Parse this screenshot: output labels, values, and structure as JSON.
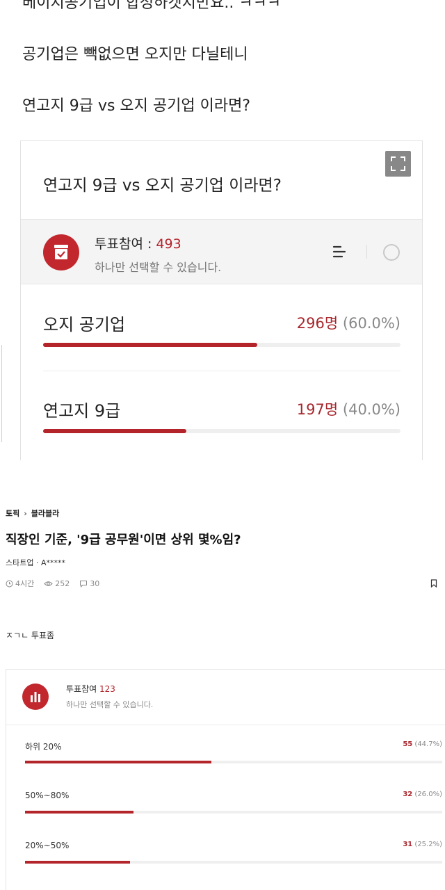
{
  "top": {
    "post_lines": [
      "베이지공기업이 합성하겟지만요.. ㅋㅋㅋ",
      "공기업은 빽없으면 오지만 다닐테니",
      "연고지 9급 vs 오지 공기업 이라면?"
    ],
    "poll": {
      "title": "연고지 9급 vs 오지 공기업 이라면?",
      "participation_label": "투표참여 : ",
      "participation_count": "493",
      "instruction": "하나만 선택할 수 있습니다.",
      "icons": {
        "expand": "expand-icon",
        "vote": "ballot-box-icon",
        "sort": "sort-icon",
        "radio": "radio-circle-icon"
      },
      "options": [
        {
          "label": "오지 공기업",
          "count": "296명",
          "percent_text": "(60.0%)",
          "fraction": 0.6
        },
        {
          "label": "연고지 9급",
          "count": "197명",
          "percent_text": "(40.0%)",
          "fraction": 0.4
        }
      ]
    }
  },
  "bottom": {
    "breadcrumb": {
      "topic": "토픽",
      "arrow": "›",
      "board": "블라블라"
    },
    "post_title": "직장인 기준, '9급 공무원'이면 상위 몇%임?",
    "author": "스타트업 · A*****",
    "meta": {
      "time": "4시간",
      "views": "252",
      "comments": "30"
    },
    "body": "ㅈㄱㄴ 투표좀",
    "poll": {
      "participation_label": "투표참여 ",
      "participation_count": "123",
      "instruction": "하나만 선택할 수 있습니다.",
      "icons": {
        "vote": "bar-chart-icon",
        "time": "clock-icon",
        "views": "eye-icon",
        "comments": "comment-icon",
        "bookmark": "bookmark-icon"
      },
      "options": [
        {
          "label": "하위 20%",
          "count": "55",
          "percent_text": "(44.7%)",
          "fraction": 0.447
        },
        {
          "label": "50%~80%",
          "count": "32",
          "percent_text": "(26.0%)",
          "fraction": 0.26
        },
        {
          "label": "20%~50%",
          "count": "31",
          "percent_text": "(25.2%)",
          "fraction": 0.252
        }
      ]
    }
  },
  "colors": {
    "accent": "#b3242b",
    "icon_bg": "#c1272d",
    "bar_track": "#efefef",
    "header_bg": "#f4f4f4"
  }
}
